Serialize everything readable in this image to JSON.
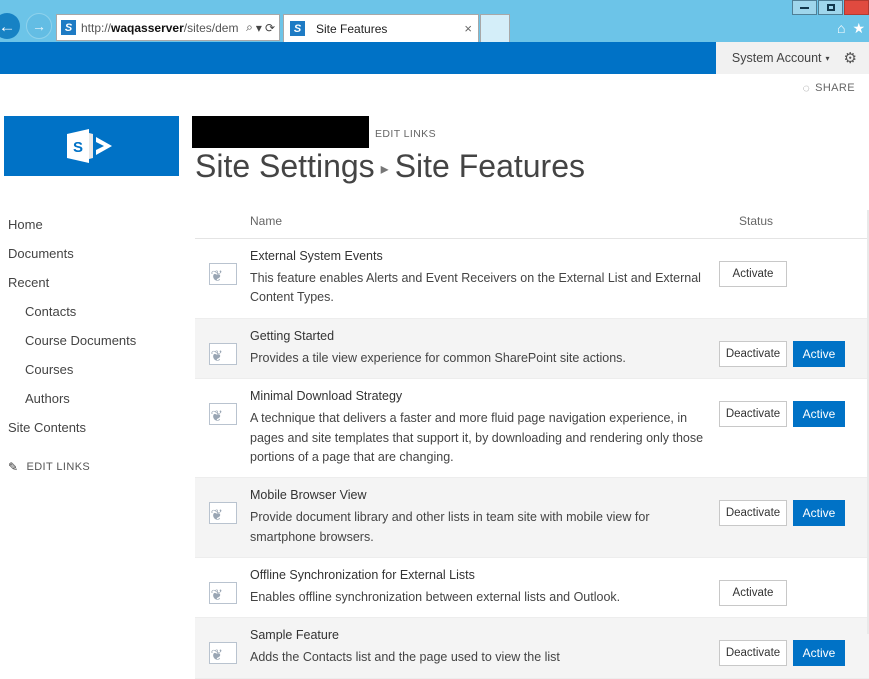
{
  "browser": {
    "back_icon": "back-arrow",
    "forward_icon": "forward-arrow",
    "favicon_letter": "S",
    "url": "http://waqasserver/sites/dem",
    "url_host": "waqasserver",
    "url_prefix": "http://",
    "url_suffix": "/sites/dem",
    "search_icon": "⌕",
    "dropdown_icon": "▾",
    "refresh_icon": "⟳",
    "tab_title": "Site Features",
    "tab_close_icon": "×",
    "home_icon": "⌂",
    "favorites_icon": "★",
    "minimize_icon": "minimize",
    "maximize_icon": "maximize",
    "close_icon": "close"
  },
  "suite": {
    "account_name": "System Account",
    "account_caret": "▾",
    "settings_icon": "⚙"
  },
  "share": {
    "label": "SHARE",
    "icon": "◌"
  },
  "branding": {
    "logo_glyph": "S",
    "edit_links_top": "EDIT LINKS"
  },
  "title": {
    "parent": "Site Settings",
    "separator": "▸",
    "current": "Site Features"
  },
  "sidebar": {
    "items": [
      {
        "label": "Home",
        "sub": false
      },
      {
        "label": "Documents",
        "sub": false
      },
      {
        "label": "Recent",
        "sub": false
      },
      {
        "label": "Contacts",
        "sub": true
      },
      {
        "label": "Course Documents",
        "sub": true
      },
      {
        "label": "Courses",
        "sub": true
      },
      {
        "label": "Authors",
        "sub": true
      },
      {
        "label": "Site Contents",
        "sub": false
      }
    ],
    "edit_links": "EDIT LINKS",
    "edit_links_icon": "✎"
  },
  "table": {
    "columns": {
      "name": "Name",
      "status": "Status"
    },
    "icon_name": "feature-puzzle-icon",
    "icon_glyph": "❦",
    "rows": [
      {
        "name": "External System Events",
        "description": "This feature enables Alerts and Event Receivers on the External List and External Content Types.",
        "action": "Activate",
        "status": ""
      },
      {
        "name": "Getting Started",
        "description": "Provides a tile view experience for common SharePoint site actions.",
        "action": "Deactivate",
        "status": "Active"
      },
      {
        "name": "Minimal Download Strategy",
        "description": "A technique that delivers a faster and more fluid page navigation experience, in pages and site templates that support it, by downloading and rendering only those portions of a page that are changing.",
        "action": "Deactivate",
        "status": "Active"
      },
      {
        "name": "Mobile Browser View",
        "description": "Provide document library and other lists in team site with mobile view for smartphone browsers.",
        "action": "Deactivate",
        "status": "Active"
      },
      {
        "name": "Offline Synchronization for External Lists",
        "description": "Enables offline synchronization between external lists and Outlook.",
        "action": "Activate",
        "status": ""
      },
      {
        "name": "Sample Feature",
        "description": "Adds the Contacts list and the page used to view the list",
        "action": "Deactivate",
        "status": "Active"
      }
    ]
  },
  "colors": {
    "suite_blue": "#0072c6",
    "chrome_blue": "#6cc4e8",
    "active_badge": "#0072c6",
    "row_alt": "#f4f4f4"
  }
}
